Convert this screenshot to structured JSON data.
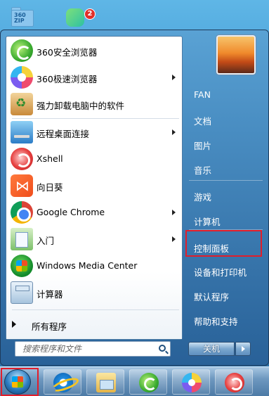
{
  "desktop": {
    "icons": [
      {
        "name": "360zip-icon",
        "label": "360 ZIP"
      },
      {
        "name": "app-icon",
        "badge": "2"
      }
    ]
  },
  "start_menu": {
    "programs": [
      {
        "label": "360安全浏览器",
        "icon": "360-safe-browser-icon",
        "submenu": false
      },
      {
        "label": "360极速浏览器",
        "icon": "360-speed-browser-icon",
        "submenu": true
      },
      {
        "label": "强力卸载电脑中的软件",
        "icon": "uninstall-icon",
        "submenu": false
      },
      {
        "label": "远程桌面连接",
        "icon": "remote-desktop-icon",
        "submenu": true
      },
      {
        "label": "Xshell",
        "icon": "xshell-icon",
        "submenu": false
      },
      {
        "label": "向日葵",
        "icon": "sunflower-icon",
        "submenu": false
      },
      {
        "label": "Google Chrome",
        "icon": "chrome-icon",
        "submenu": true
      },
      {
        "label": "入门",
        "icon": "getting-started-icon",
        "submenu": true
      },
      {
        "label": "Windows Media Center",
        "icon": "windows-media-center-icon",
        "submenu": false
      },
      {
        "label": "计算器",
        "icon": "calculator-icon",
        "submenu": false
      }
    ],
    "all_programs": "所有程序",
    "search": {
      "placeholder": "搜索程序和文件",
      "value": ""
    },
    "right_items": [
      {
        "label": "FAN"
      },
      {
        "label": "文档"
      },
      {
        "label": "图片"
      },
      {
        "label": "音乐"
      },
      {
        "label": "游戏"
      },
      {
        "label": "计算机"
      },
      {
        "label": "控制面板",
        "highlighted": true
      },
      {
        "label": "设备和打印机"
      },
      {
        "label": "默认程序"
      },
      {
        "label": "帮助和支持"
      }
    ],
    "shutdown_label": "关机"
  },
  "taskbar": {
    "start_highlighted": true,
    "pinned": [
      "internet-explorer-icon",
      "file-explorer-icon",
      "360-safe-browser-icon",
      "360-speed-browser-icon",
      "xshell-icon"
    ]
  },
  "colors": {
    "highlight_red": "#e11e2b",
    "menu_blue": "#2b6fa6"
  }
}
